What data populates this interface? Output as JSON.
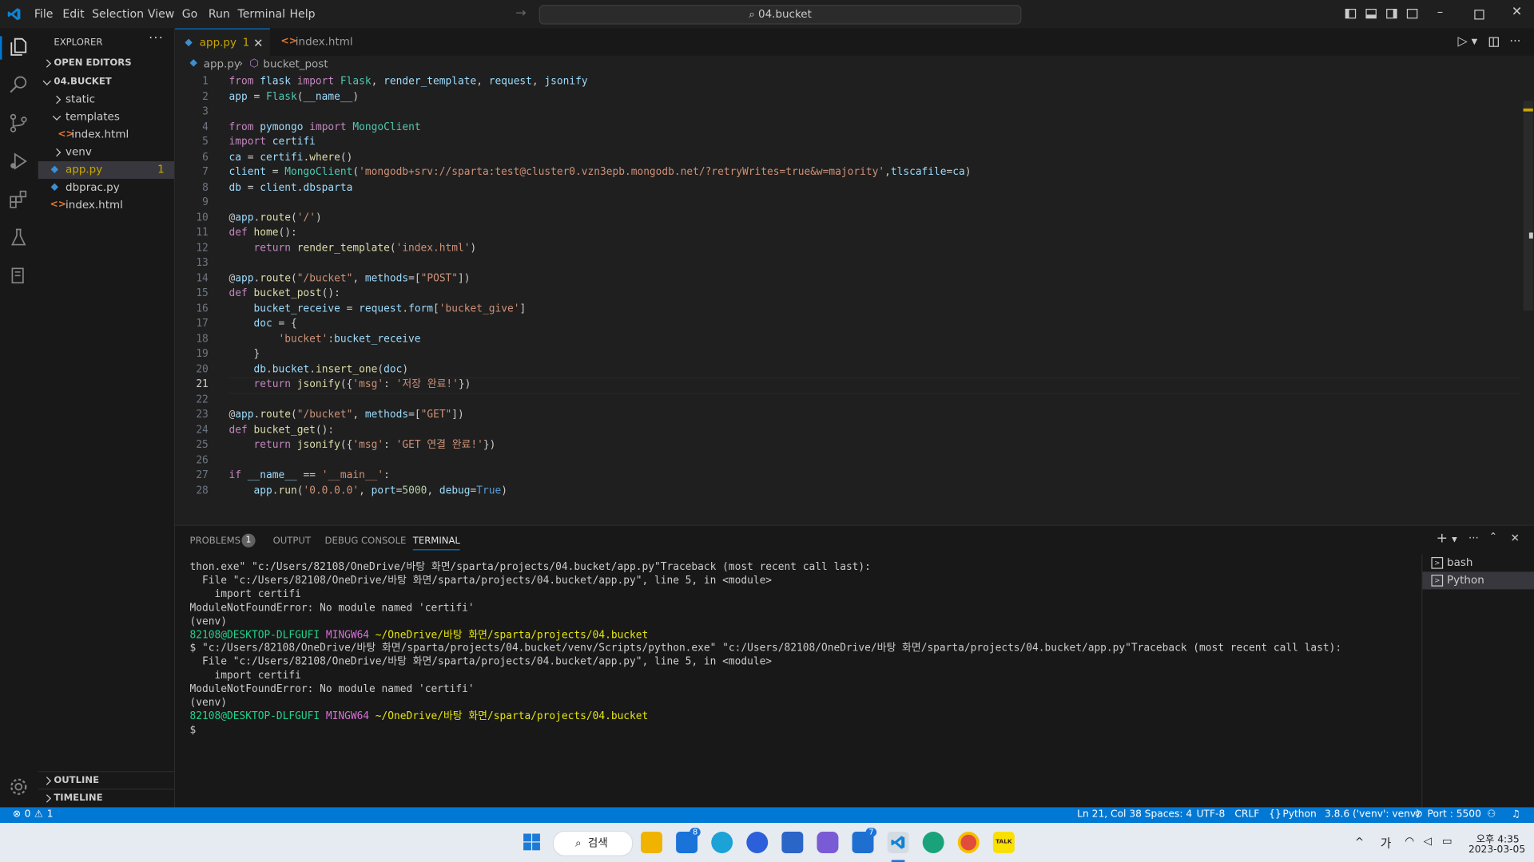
{
  "titlebar": {
    "menu": [
      "File",
      "Edit",
      "Selection",
      "View",
      "Go",
      "Run",
      "Terminal",
      "Help"
    ],
    "search_text": "04.bucket"
  },
  "explorer": {
    "header": "EXPLORER",
    "open_editors": "OPEN EDITORS",
    "folder": "04.BUCKET",
    "items": [
      {
        "label": "static",
        "type": "folder"
      },
      {
        "label": "templates",
        "type": "folder-open"
      },
      {
        "label": "index.html",
        "type": "html"
      },
      {
        "label": "venv",
        "type": "folder"
      },
      {
        "label": "app.py",
        "type": "py",
        "badge": "1"
      },
      {
        "label": "dbprac.py",
        "type": "py"
      },
      {
        "label": "index.html",
        "type": "html"
      }
    ],
    "outline": "OUTLINE",
    "timeline": "TIMELINE"
  },
  "tabs": [
    {
      "label": "app.py",
      "badge": "1"
    },
    {
      "label": "index.html"
    }
  ],
  "breadcrumbs": {
    "file": "app.py",
    "symbol": "bucket_post"
  },
  "code": {
    "lines": [
      "from flask import Flask, render_template, request, jsonify",
      "app = Flask(__name__)",
      "",
      "from pymongo import MongoClient",
      "import certifi",
      "ca = certifi.where()",
      "client = MongoClient('mongodb+srv://sparta:test@cluster0.vzn3epb.mongodb.net/?retryWrites=true&w=majority',tlscafile=ca)",
      "db = client.dbsparta",
      "",
      "@app.route('/')",
      "def home():",
      "    return render_template('index.html')",
      "",
      "@app.route(\"/bucket\", methods=[\"POST\"])",
      "def bucket_post():",
      "    bucket_receive = request.form['bucket_give']",
      "    doc = {",
      "        'bucket':bucket_receive",
      "    }",
      "    db.bucket.insert_one(doc)",
      "    return jsonify({'msg': '저장 완료!'})",
      "",
      "@app.route(\"/bucket\", methods=[\"GET\"])",
      "def bucket_get():",
      "    return jsonify({'msg': 'GET 연결 완료!'})",
      "",
      "if __name__ == '__main__':",
      "    app.run('0.0.0.0', port=5000, debug=True)"
    ],
    "current_line": 21
  },
  "panel": {
    "tabs": [
      "PROBLEMS",
      "OUTPUT",
      "DEBUG CONSOLE",
      "TERMINAL"
    ],
    "problems_count": "1",
    "active_tab": "TERMINAL",
    "terminals": [
      "bash",
      "Python"
    ],
    "lines": [
      {
        "text": "thon.exe\" \"c:/Users/82108/OneDrive/바탕 화면/sparta/projects/04.bucket/app.py\"Traceback (most recent call last):",
        "kind": "plain"
      },
      {
        "text": "  File \"c:/Users/82108/OneDrive/바탕 화면/sparta/projects/04.bucket/app.py\", line 5, in <module>",
        "kind": "plain"
      },
      {
        "text": "    import certifi",
        "kind": "plain"
      },
      {
        "text": "ModuleNotFoundError: No module named 'certifi'",
        "kind": "plain"
      },
      {
        "text": "(venv)",
        "kind": "plain"
      },
      {
        "user": "82108@DESKTOP-DLFGUFI",
        "shell": "MINGW64",
        "path": "~/OneDrive/바탕 화면/sparta/projects/04.bucket",
        "kind": "prompt"
      },
      {
        "text": "$ \"c:/Users/82108/OneDrive/바탕 화면/sparta/projects/04.bucket/venv/Scripts/python.exe\" \"c:/Users/82108/OneDrive/바탕 화면/sparta/projects/04.bucket/app.py\"Traceback (most recent call last):",
        "kind": "plain"
      },
      {
        "text": "  File \"c:/Users/82108/OneDrive/바탕 화면/sparta/projects/04.bucket/app.py\", line 5, in <module>",
        "kind": "plain"
      },
      {
        "text": "    import certifi",
        "kind": "plain"
      },
      {
        "text": "ModuleNotFoundError: No module named 'certifi'",
        "kind": "plain"
      },
      {
        "text": "(venv)",
        "kind": "plain"
      },
      {
        "user": "82108@DESKTOP-DLFGUFI",
        "shell": "MINGW64",
        "path": "~/OneDrive/바탕 화면/sparta/projects/04.bucket",
        "kind": "prompt"
      },
      {
        "text": "$",
        "kind": "plain"
      }
    ]
  },
  "statusbar": {
    "errors": "0",
    "warnings": "1",
    "position": "Ln 21, Col 38",
    "spaces": "Spaces: 4",
    "encoding": "UTF-8",
    "eol": "CRLF",
    "language": "Python",
    "interpreter": "3.8.6 ('venv': venv)",
    "port": "Port : 5500"
  },
  "taskbar": {
    "search_label": "검색",
    "mail_badge": "8",
    "todo_badge": "7",
    "ime": "가",
    "time": "오후 4:35",
    "date": "2023-03-05",
    "kakao_label": "TALK"
  },
  "colors": {
    "accent": "#0078d4",
    "statusbar": "#0078d4",
    "error": "#f14c4c",
    "warning_badge": "#cca700"
  }
}
